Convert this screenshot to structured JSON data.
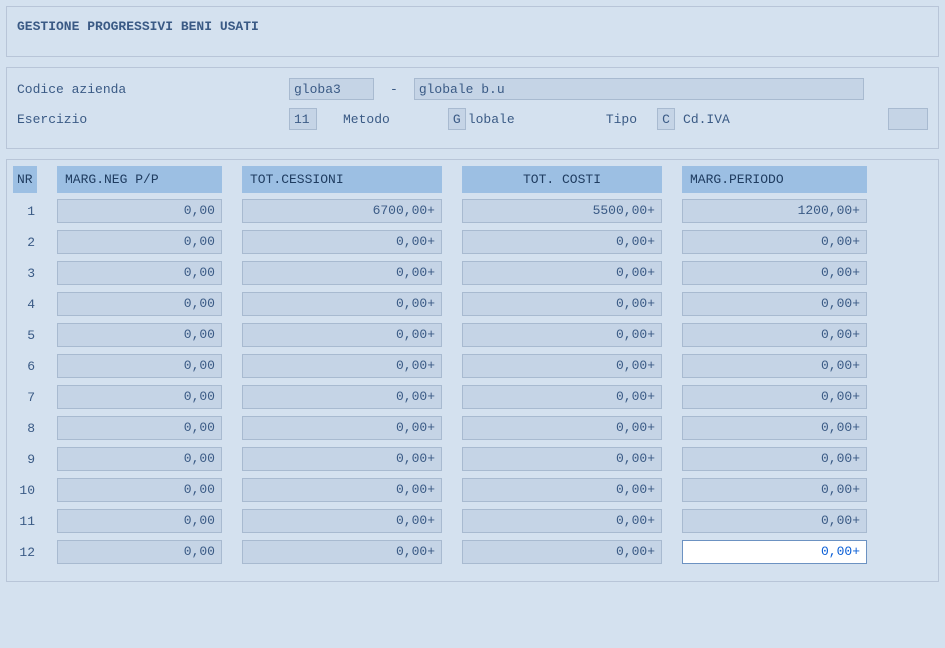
{
  "title": "GESTIONE PROGRESSIVI BENI USATI",
  "header": {
    "codice_label": "Codice azienda",
    "codice_value": "globa3",
    "codice_sep": "-",
    "codice_desc": "globale b.u",
    "esercizio_label": "Esercizio",
    "esercizio_value": "11",
    "metodo_label": "Metodo",
    "metodo_g": "G",
    "metodo_value": "lobale",
    "tipo_label": "Tipo",
    "tipo_value": "C",
    "cdiva_label": "Cd.IVA",
    "cdiva_value": ""
  },
  "table": {
    "headers": {
      "nr": "NR",
      "c1": "MARG.NEG P/P",
      "c2": "TOT.CESSIONI",
      "c3": "TOT. COSTI",
      "c4": "MARG.PERIODO"
    },
    "rows": [
      {
        "nr": "1",
        "c1": "0,00",
        "c2": "6700,00+",
        "c3": "5500,00+",
        "c4": "1200,00+"
      },
      {
        "nr": "2",
        "c1": "0,00",
        "c2": "0,00+",
        "c3": "0,00+",
        "c4": "0,00+"
      },
      {
        "nr": "3",
        "c1": "0,00",
        "c2": "0,00+",
        "c3": "0,00+",
        "c4": "0,00+"
      },
      {
        "nr": "4",
        "c1": "0,00",
        "c2": "0,00+",
        "c3": "0,00+",
        "c4": "0,00+"
      },
      {
        "nr": "5",
        "c1": "0,00",
        "c2": "0,00+",
        "c3": "0,00+",
        "c4": "0,00+"
      },
      {
        "nr": "6",
        "c1": "0,00",
        "c2": "0,00+",
        "c3": "0,00+",
        "c4": "0,00+"
      },
      {
        "nr": "7",
        "c1": "0,00",
        "c2": "0,00+",
        "c3": "0,00+",
        "c4": "0,00+"
      },
      {
        "nr": "8",
        "c1": "0,00",
        "c2": "0,00+",
        "c3": "0,00+",
        "c4": "0,00+"
      },
      {
        "nr": "9",
        "c1": "0,00",
        "c2": "0,00+",
        "c3": "0,00+",
        "c4": "0,00+"
      },
      {
        "nr": "10",
        "c1": "0,00",
        "c2": "0,00+",
        "c3": "0,00+",
        "c4": "0,00+"
      },
      {
        "nr": "11",
        "c1": "0,00",
        "c2": "0,00+",
        "c3": "0,00+",
        "c4": "0,00+"
      },
      {
        "nr": "12",
        "c1": "0,00",
        "c2": "0,00+",
        "c3": "0,00+",
        "c4": "0,00+"
      }
    ],
    "active_cell": {
      "row": 11,
      "col": "c4"
    }
  }
}
